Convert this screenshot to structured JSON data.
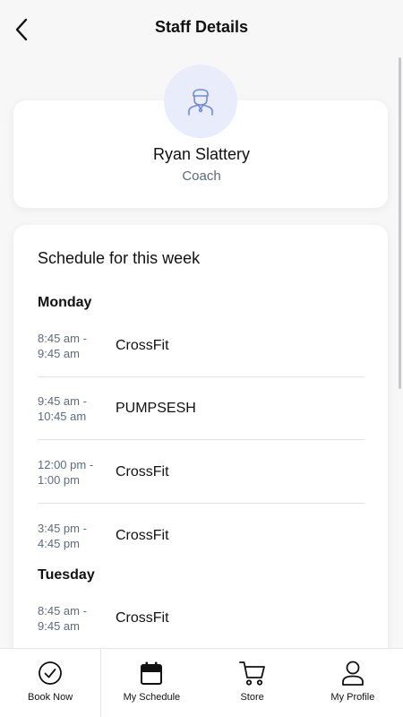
{
  "header": {
    "title": "Staff Details",
    "back_icon": "chevron-left-icon"
  },
  "profile": {
    "name": "Ryan Slattery",
    "role": "Coach",
    "avatar_icon": "user-icon",
    "avatar_bg": "#e8ecfb",
    "avatar_fg": "#6f8bd8"
  },
  "schedule": {
    "title": "Schedule for this week",
    "days": [
      {
        "day": "Monday",
        "classes": [
          {
            "time": "8:45 am -\n9:45 am",
            "name": "CrossFit"
          },
          {
            "time": "9:45 am -\n10:45 am",
            "name": "PUMPSESH"
          },
          {
            "time": "12:00 pm -\n1:00 pm",
            "name": "CrossFit"
          },
          {
            "time": "3:45 pm -\n4:45 pm",
            "name": "CrossFit"
          }
        ]
      },
      {
        "day": "Tuesday",
        "classes": [
          {
            "time": "8:45 am -\n9:45 am",
            "name": "CrossFit"
          }
        ]
      }
    ]
  },
  "bottom_nav": {
    "items": [
      {
        "label": "Book Now",
        "icon": "check-circle-icon"
      },
      {
        "label": "My Schedule",
        "icon": "calendar-icon"
      },
      {
        "label": "Store",
        "icon": "cart-icon"
      },
      {
        "label": "My Profile",
        "icon": "person-icon"
      }
    ]
  }
}
